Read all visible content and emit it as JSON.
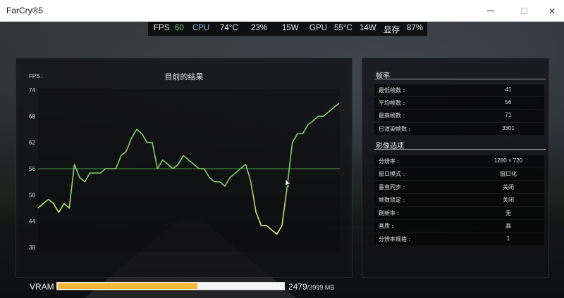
{
  "window": {
    "title": "FarCry®5"
  },
  "stats_bar": {
    "fps_label": "FPS",
    "fps_value": "60",
    "cpu_label": "CPU",
    "cpu_temp": "74°C",
    "cpu_usage": "23%",
    "cpu_power": "15W",
    "gpu_label": "GPU",
    "gpu_temp": "55°C",
    "gpu_power": "14W",
    "vram_label": "显存",
    "vram_usage": "87%"
  },
  "chart": {
    "title": "目前的结果",
    "y_axis_title": "FPS :",
    "colors": {
      "line_high": "#7fd06a",
      "line_low": "#e6e67a",
      "reference": "#49a04a"
    }
  },
  "chart_data": {
    "type": "line",
    "title": "目前的结果",
    "ylabel": "FPS :",
    "ylim": [
      38,
      74
    ],
    "yticks": [
      "74",
      "68",
      "62",
      "56",
      "50",
      "44",
      "38"
    ],
    "ytick_values": [
      74,
      68,
      62,
      56,
      50,
      44,
      38
    ],
    "reference_line": 56,
    "series": [
      {
        "values": [
          47,
          48,
          49,
          48,
          46,
          48,
          47,
          57,
          54,
          53,
          55,
          55,
          55,
          56,
          56,
          56,
          59,
          60,
          63,
          65,
          64,
          62,
          62,
          56,
          58,
          57,
          56,
          57,
          59,
          58,
          57,
          56,
          56,
          54,
          53,
          53,
          52,
          54,
          55,
          56,
          57,
          53,
          46,
          43,
          43,
          42,
          41,
          43,
          52,
          62,
          64,
          64,
          66,
          67,
          68,
          68,
          69,
          70,
          71
        ]
      }
    ]
  },
  "fps_section": {
    "title": "帧率",
    "rows": [
      {
        "label": "最低帧数 :",
        "value": "41"
      },
      {
        "label": "平均帧数 :",
        "value": "56"
      },
      {
        "label": "最高帧数 :",
        "value": "71"
      },
      {
        "label": "已渲染帧数 :",
        "value": "3301"
      }
    ]
  },
  "video_section": {
    "title": "影像选项",
    "rows": [
      {
        "label": "分辨率 :",
        "value": "1280 × 720"
      },
      {
        "label": "窗口模式 :",
        "value": "窗口化"
      },
      {
        "label": "垂直同步 :",
        "value": "关闭"
      },
      {
        "label": "帧数锁定 :",
        "value": "关闭"
      },
      {
        "label": "刷新率 :",
        "value": "无"
      },
      {
        "label": "画质 :",
        "value": "高"
      },
      {
        "label": "分辨率规格 :",
        "value": "1"
      }
    ]
  },
  "vram": {
    "label": "VRAM",
    "used": "2479",
    "total": "/3999 MB",
    "fill_fraction": 0.62,
    "bar_color": "#f5b836"
  }
}
